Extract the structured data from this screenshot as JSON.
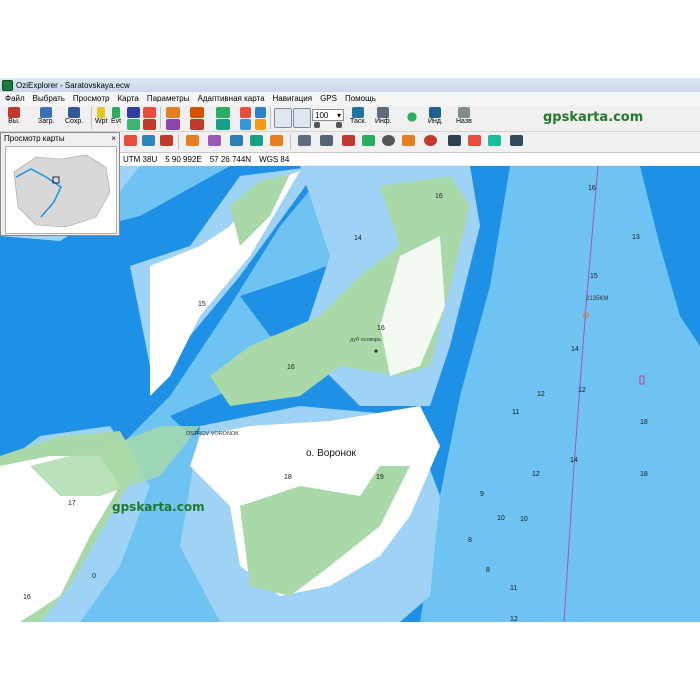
{
  "window": {
    "title": "OziExplorer - Saratovskaya.ecw"
  },
  "menu": [
    "Файл",
    "Выбрать",
    "Просмотр",
    "Карта",
    "Параметры",
    "Адаптивная карта",
    "Навигация",
    "GPS",
    "Помощь"
  ],
  "toolbar": {
    "exit_label": "Вы.",
    "load_label": "Загр.",
    "save_label": "Сохр.",
    "wpt_label": "Wpt",
    "evt_label": "Evt",
    "zoom_value": "100",
    "tasks_label": "Таск.",
    "info_label": "Инф.",
    "ind_label": "Инд.",
    "nav_label": "Назв",
    "brand": "gpskarta.com"
  },
  "overview": {
    "title": "Просмотр карты",
    "close_label": "×"
  },
  "coords": {
    "zone": "UTM 38U",
    "easting": "5 90 992E",
    "northing": "57 26 744N",
    "datum": "WGS 84"
  },
  "map": {
    "island_label": "о. Воронок",
    "island_label_latin": "OSTROV VORONOK",
    "tree_label": "дуб осокорь",
    "km_label": "2135KM",
    "watermark": "gpskarta.com",
    "depths": [
      "16",
      "14",
      "15",
      "16",
      "16",
      "18",
      "19",
      "17",
      "16",
      "0",
      "16",
      "15",
      "14",
      "12",
      "12",
      "18",
      "18",
      "14",
      "10",
      "11",
      "12",
      "8",
      "11",
      "12",
      "13",
      "9",
      "10",
      "8"
    ]
  },
  "colors": {
    "deep_water": "#1e90e6",
    "shallow_water": "#9fd3f5",
    "mid_water": "#6ec3f2",
    "land_green": "#a9d9a8",
    "sand": "#ffffff",
    "channel_line": "#a050d0"
  }
}
